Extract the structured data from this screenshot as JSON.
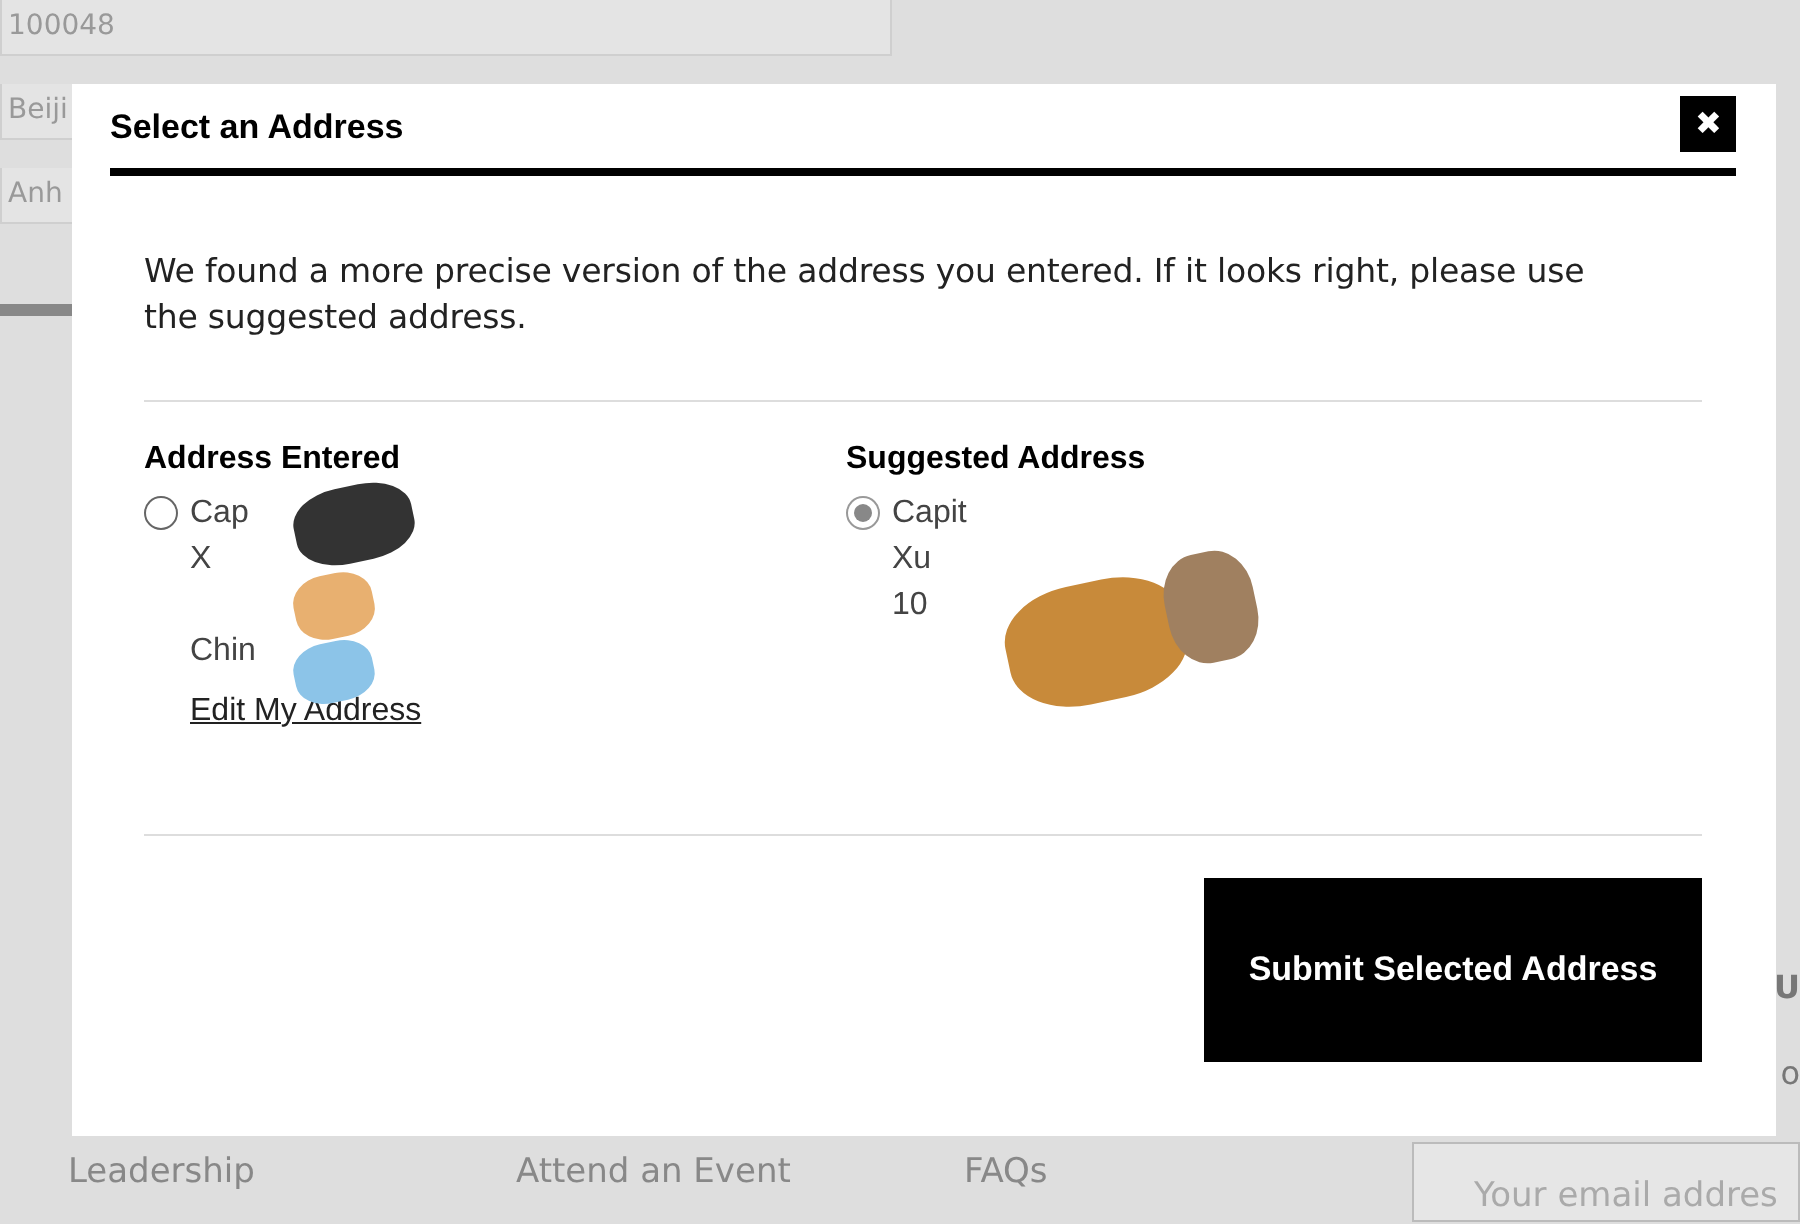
{
  "background": {
    "postal_field": {
      "value": "100048"
    },
    "city_field": {
      "value": "Beiji"
    },
    "district_field": {
      "value": "Anh"
    },
    "right_fragments": [
      "U",
      "o"
    ],
    "footer_links": [
      "Leadership",
      "Attend an Event",
      "FAQs"
    ],
    "email_field": {
      "placeholder": "Your email addres"
    }
  },
  "dialog": {
    "title": "Select an Address",
    "close": "✖",
    "message": "We found a more precise version of the address you entered. If it looks right, please use the suggested address.",
    "options": [
      {
        "heading": "Address Entered",
        "selected": false,
        "lines": [
          "Cap",
          "X",
          "Chin"
        ],
        "link": "Edit My Address"
      },
      {
        "heading": "Suggested Address",
        "selected": true,
        "lines": [
          "Capit",
          "Xu",
          "10"
        ]
      }
    ],
    "submit": "Submit Selected Address"
  }
}
